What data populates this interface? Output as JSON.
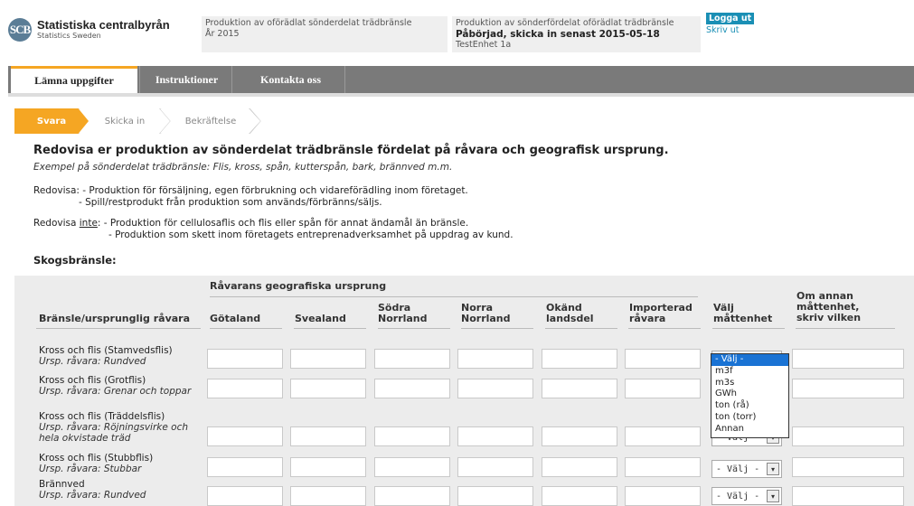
{
  "header": {
    "logo_mark": "SCB",
    "org_name": "Statistiska centralbyrån",
    "org_sub": "Statistics Sweden",
    "box1": [
      "Produktion av oförädlat sönderdelat trädbränsle",
      "År 2015"
    ],
    "box2": [
      "Produktion av sönderfördelat oförädlat trädbränsle",
      "Påbörjad, skicka in senast 2015-05-18",
      "TestEnhet 1a"
    ],
    "logout": "Logga ut",
    "print": "Skriv ut"
  },
  "nav": {
    "tabs": [
      "Lämna uppgifter",
      "Instruktioner",
      "Kontakta oss"
    ]
  },
  "steps": [
    "Svara",
    "Skicka in",
    "Bekräftelse"
  ],
  "content": {
    "title": "Redovisa er produktion av sönderdelat trädbränsle fördelat på råvara och geografisk ursprung.",
    "example": "Exempel på sönderdelat trädbränsle: Flis, kross, spån, kutterspån, bark, brännved m.m.",
    "redovisa_label": "Redovisa:",
    "redovisa_1": "- Produktion för försäljning, egen förbrukning och vidareförädling inom företaget.",
    "redovisa_2": "- Spill/restprodukt från produktion som används/förbränns/säljs.",
    "inte_prefix": "Redovisa ",
    "inte_word": "inte",
    "inte_1": ": - Produktion för cellulosaflis och flis eller spån för annat ändamål än bränsle.",
    "inte_2": "- Produktion som skett inom företagets entreprenadverksamhet på uppdrag av kund.",
    "section": "Skogsbränsle:"
  },
  "table": {
    "group_header": "Råvarans geografiska ursprung",
    "col_label": "Bränsle/ursprunglig råvara",
    "columns": [
      "Götaland",
      "Svealand",
      "Södra Norrland",
      "Norra Norrland",
      "Okänd landsdel",
      "Importerad råvara"
    ],
    "col_valj": "Välj måttenhet",
    "col_annan": "Om annan måttenhet, skriv vilken",
    "rows": [
      {
        "name": "Kross och flis (Stamvedsflis)",
        "sub": "Ursp. råvara: Rundved"
      },
      {
        "name": "Kross och flis (Grotflis)",
        "sub": "Ursp. råvara: Grenar och toppar"
      },
      {
        "name": "Kross och flis (Träddelsflis)",
        "sub": "Ursp. råvara: Röjningsvirke och hela okvistade träd"
      },
      {
        "name": "Kross och flis (Stubbflis)",
        "sub": "Ursp. råvara: Stubbar"
      },
      {
        "name": "Brännved",
        "sub": "Ursp. råvara: Rundved"
      }
    ],
    "select_value": "- Välj -",
    "dropdown_options": [
      "- Välj -",
      "m3f",
      "m3s",
      "GWh",
      "ton (rå)",
      "ton (torr)",
      "Annan"
    ],
    "dropdown_arrow": "▾"
  }
}
